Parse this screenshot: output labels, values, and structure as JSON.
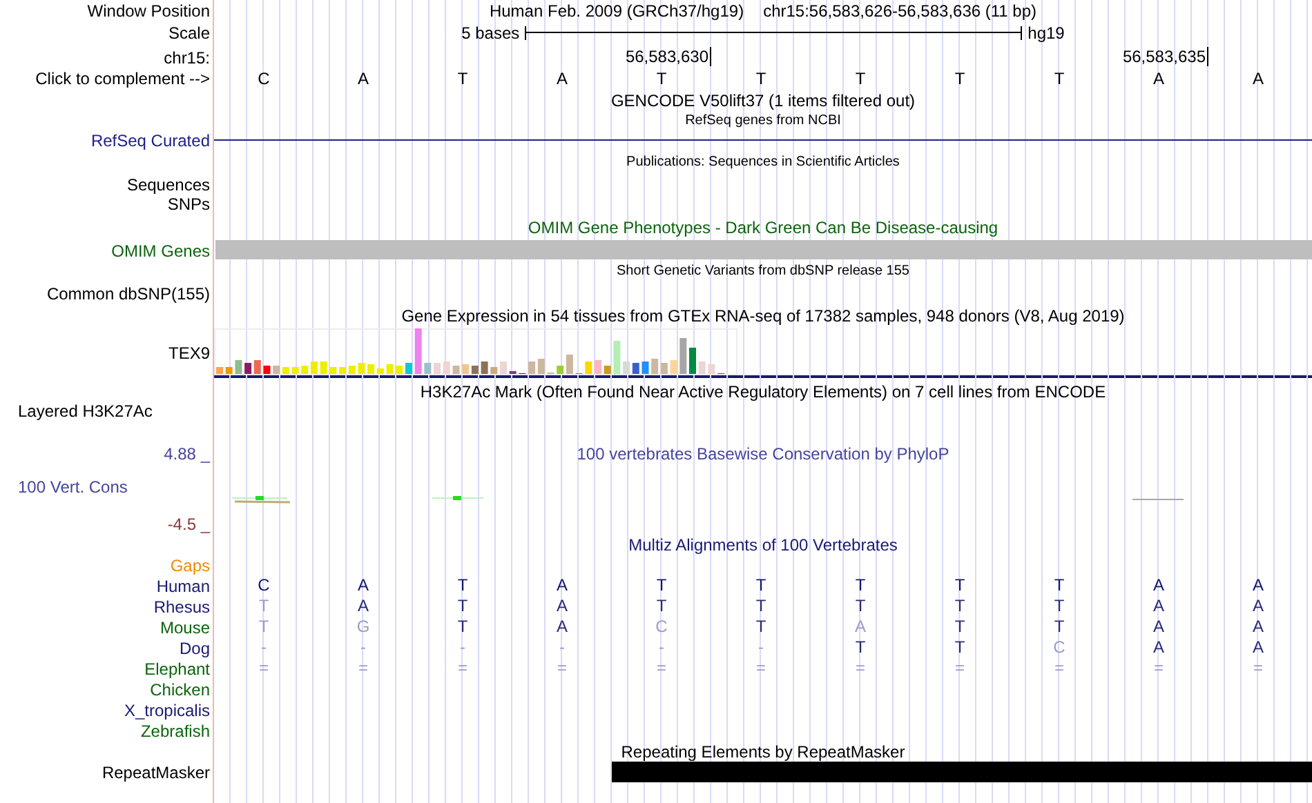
{
  "header": {
    "label": "Window Position",
    "assembly": "Human Feb. 2009 (GRCh37/hg19)",
    "position": "chr15:56,583,626-56,583,636 (11 bp)"
  },
  "scale": {
    "label": "Scale",
    "bar_label": "5 bases",
    "assembly": "hg19"
  },
  "coordinates": {
    "label": "chr15:",
    "ticks": [
      "56,583,630",
      "56,583,635"
    ]
  },
  "sequence": {
    "label": "Click to complement -->",
    "bases": [
      "C",
      "A",
      "T",
      "A",
      "T",
      "T",
      "T",
      "T",
      "T",
      "A",
      "A"
    ]
  },
  "tracks": [
    {
      "kind": "header",
      "title": "GENCODE V50lift37 (1 items filtered out)"
    },
    {
      "kind": "line",
      "description": "RefSeq genes from NCBI",
      "label": "RefSeq Curated",
      "color": "#20208c"
    },
    {
      "kind": "empty",
      "description": "Publications: Sequences in Scientific Articles",
      "labels": [
        "Sequences",
        "SNPs"
      ]
    },
    {
      "kind": "bar",
      "title": "OMIM Gene Phenotypes - Dark Green Can Be Disease-causing",
      "label": "OMIM Genes",
      "color": "#0b650b"
    },
    {
      "kind": "empty",
      "description": "Short Genetic Variants from dbSNP release 155",
      "labels": [
        "Common dbSNP(155)"
      ]
    },
    {
      "kind": "expression",
      "title": "Gene Expression in 54 tissues from GTEx RNA-seq of 17382 samples, 948 donors (V8, Aug 2019)",
      "label": "TEX9"
    },
    {
      "kind": "layered",
      "title": "H3K27Ac Mark (Often Found Near Active Regulatory Elements) on 7 cell lines from ENCODE",
      "label": "Layered H3K27Ac"
    },
    {
      "kind": "conservation",
      "title": "100 vertebrates Basewise Conservation by PhyloP",
      "label": "100 Vert. Cons",
      "color": "#45459c",
      "max": "4.88 _",
      "min": "-4.5 _"
    },
    {
      "kind": "alignment",
      "title": "Multiz Alignments of 100 Vertebrates",
      "color": "#1a1a72",
      "gaps": {
        "label": "Gaps",
        "color": "#ee8a0a"
      },
      "species": [
        {
          "name": "Human",
          "color": "#1a1a72",
          "bases": [
            {
              "base": "C",
              "differs": false
            },
            {
              "base": "A",
              "differs": false
            },
            {
              "base": "T",
              "differs": false
            },
            {
              "base": "A",
              "differs": false
            },
            {
              "base": "T",
              "differs": false
            },
            {
              "base": "T",
              "differs": false
            },
            {
              "base": "T",
              "differs": false
            },
            {
              "base": "T",
              "differs": false
            },
            {
              "base": "T",
              "differs": false
            },
            {
              "base": "A",
              "differs": false
            },
            {
              "base": "A",
              "differs": false
            }
          ]
        },
        {
          "name": "Rhesus",
          "color": "#1a1a72",
          "bases": [
            {
              "base": "T",
              "differs": true
            },
            {
              "base": "A",
              "differs": false
            },
            {
              "base": "T",
              "differs": false
            },
            {
              "base": "A",
              "differs": false
            },
            {
              "base": "T",
              "differs": false
            },
            {
              "base": "T",
              "differs": false
            },
            {
              "base": "T",
              "differs": false
            },
            {
              "base": "T",
              "differs": false
            },
            {
              "base": "T",
              "differs": false
            },
            {
              "base": "A",
              "differs": false
            },
            {
              "base": "A",
              "differs": false
            }
          ]
        },
        {
          "name": "Mouse",
          "color": "#0b650b",
          "bases": [
            {
              "base": "T",
              "differs": true
            },
            {
              "base": "G",
              "differs": true
            },
            {
              "base": "T",
              "differs": false
            },
            {
              "base": "A",
              "differs": false
            },
            {
              "base": "C",
              "differs": true
            },
            {
              "base": "T",
              "differs": false
            },
            {
              "base": "A",
              "differs": true
            },
            {
              "base": "T",
              "differs": false
            },
            {
              "base": "T",
              "differs": false
            },
            {
              "base": "A",
              "differs": false
            },
            {
              "base": "A",
              "differs": false
            }
          ]
        },
        {
          "name": "Dog",
          "color": "#1a1a72",
          "bases": [
            {
              "base": "-",
              "differs": true
            },
            {
              "base": "-",
              "differs": true
            },
            {
              "base": "-",
              "differs": true
            },
            {
              "base": "-",
              "differs": true
            },
            {
              "base": "-",
              "differs": true
            },
            {
              "base": "-",
              "differs": true
            },
            {
              "base": "T",
              "differs": false
            },
            {
              "base": "T",
              "differs": false
            },
            {
              "base": "C",
              "differs": true
            },
            {
              "base": "A",
              "differs": false
            },
            {
              "base": "A",
              "differs": false
            }
          ]
        },
        {
          "name": "Elephant",
          "color": "#0b650b",
          "bases": [
            {
              "base": "=",
              "differs": true
            },
            {
              "base": "=",
              "differs": true
            },
            {
              "base": "=",
              "differs": true
            },
            {
              "base": "=",
              "differs": true
            },
            {
              "base": "=",
              "differs": true
            },
            {
              "base": "=",
              "differs": true
            },
            {
              "base": "=",
              "differs": true
            },
            {
              "base": "=",
              "differs": true
            },
            {
              "base": "=",
              "differs": true
            },
            {
              "base": "=",
              "differs": true
            },
            {
              "base": "=",
              "differs": true
            }
          ]
        },
        {
          "name": "Chicken",
          "color": "#0b650b"
        },
        {
          "name": "X_tropicalis",
          "color": "#1a1a72"
        },
        {
          "name": "Zebrafish",
          "color": "#0b650b"
        }
      ]
    },
    {
      "kind": "block",
      "title": "Repeating Elements by RepeatMasker",
      "label": "RepeatMasker"
    }
  ]
}
